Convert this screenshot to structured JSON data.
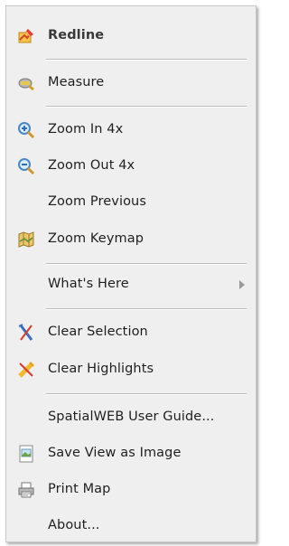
{
  "menu": {
    "items": [
      {
        "label": "Redline",
        "icon": "redline-icon"
      },
      {
        "label": "Measure",
        "icon": "measure-icon"
      },
      {
        "label": "Zoom In 4x",
        "icon": "zoom-in-icon"
      },
      {
        "label": "Zoom Out 4x",
        "icon": "zoom-out-icon"
      },
      {
        "label": "Zoom Previous",
        "icon": ""
      },
      {
        "label": "Zoom Keymap",
        "icon": "keymap-icon"
      },
      {
        "label": "What's Here",
        "icon": "",
        "submenu": true
      },
      {
        "label": "Clear Selection",
        "icon": "clear-selection-icon"
      },
      {
        "label": "Clear Highlights",
        "icon": "clear-highlights-icon"
      },
      {
        "label": "SpatialWEB User Guide...",
        "icon": ""
      },
      {
        "label": "Save View as Image",
        "icon": "save-image-icon"
      },
      {
        "label": "Print Map",
        "icon": "print-icon"
      },
      {
        "label": "About...",
        "icon": ""
      }
    ]
  },
  "colors": {
    "background": "#efefef",
    "separator": "#bdbdbd",
    "text": "#1f1f1f"
  }
}
